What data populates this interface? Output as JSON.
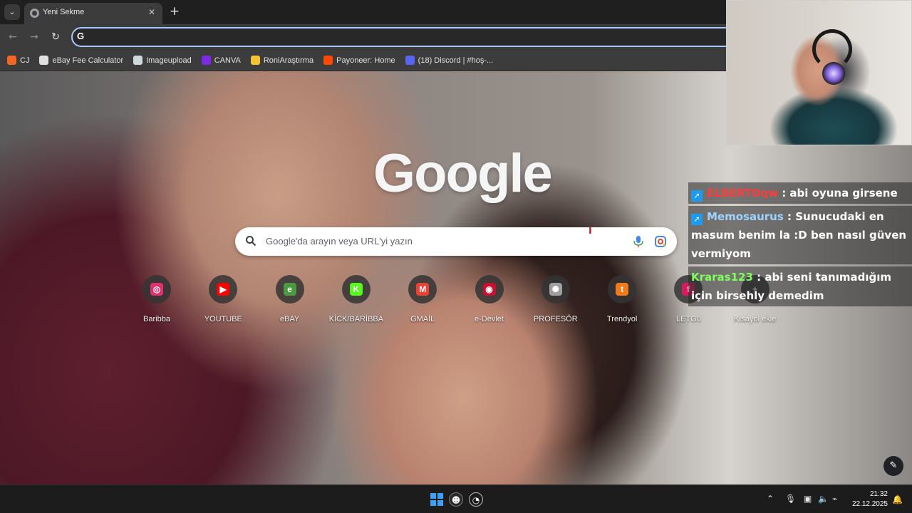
{
  "browser": {
    "tab": {
      "title": "Yeni Sekme",
      "close_glyph": "✕"
    },
    "new_tab_glyph": "+",
    "omnibox": {
      "value": "",
      "placeholder": ""
    },
    "bookmarks": [
      {
        "label": "CJ",
        "icon": "cj-icon",
        "color": "#f26522"
      },
      {
        "label": "eBay Fee Calculator",
        "icon": "grid-icon",
        "color": "#e0e0e0"
      },
      {
        "label": "Imageupload",
        "icon": "imageupload-icon",
        "color": "#cfd8dc"
      },
      {
        "label": "CANVA",
        "icon": "canva-heart-icon",
        "color": "#7d2ae8"
      },
      {
        "label": "RoniAraştırma",
        "icon": "roni-icon",
        "color": "#f2c230"
      },
      {
        "label": "Payoneer: Home",
        "icon": "payoneer-icon",
        "color": "#ff4800"
      },
      {
        "label": "(18) Discord | #hoş-...",
        "icon": "discord-icon",
        "color": "#5865f2"
      }
    ]
  },
  "ntp": {
    "logo": "Google",
    "search_placeholder": "Google'da arayın veya URL'yi yazın",
    "shortcuts": [
      {
        "label": "Baribba",
        "glyph": "◎",
        "color": "#e1306c"
      },
      {
        "label": "YOUTUBE",
        "glyph": "▶",
        "color": "#ff0000"
      },
      {
        "label": "eBAY",
        "glyph": "e",
        "color": "#4a9b3f"
      },
      {
        "label": "KİCK/BARİBBA",
        "glyph": "K",
        "color": "#53fc18"
      },
      {
        "label": "GMAİL",
        "glyph": "M",
        "color": "#ea4335"
      },
      {
        "label": "e-Devlet",
        "glyph": "◉",
        "color": "#c8102e"
      },
      {
        "label": "PROFESÖR",
        "glyph": "✺",
        "color": "#9e9e9e"
      },
      {
        "label": "Trendyol",
        "glyph": "t",
        "color": "#f27a1a"
      },
      {
        "label": "LETG0",
        "glyph": "f",
        "color": "#d81b60"
      },
      {
        "label": "Kısayol ekle",
        "glyph": "+",
        "color": "#444444"
      }
    ]
  },
  "chat": [
    {
      "user": "ELBERTOqw",
      "user_color": "#ff3b3b",
      "text": ": abi oyuna girsene",
      "badge": true
    },
    {
      "user": "Memosaurus",
      "user_color": "#9fd3ff",
      "text": ": Sunucudaki en masum benim la :D ben nasıl güven vermiyom",
      "badge": true
    },
    {
      "user": "Kraras123",
      "user_color": "#7dff5a",
      "text": ": abi seni tanımadığım için birsehly demedim",
      "badge": false
    }
  ],
  "taskbar": {
    "time": "21:32",
    "date": "22.12.2025"
  }
}
